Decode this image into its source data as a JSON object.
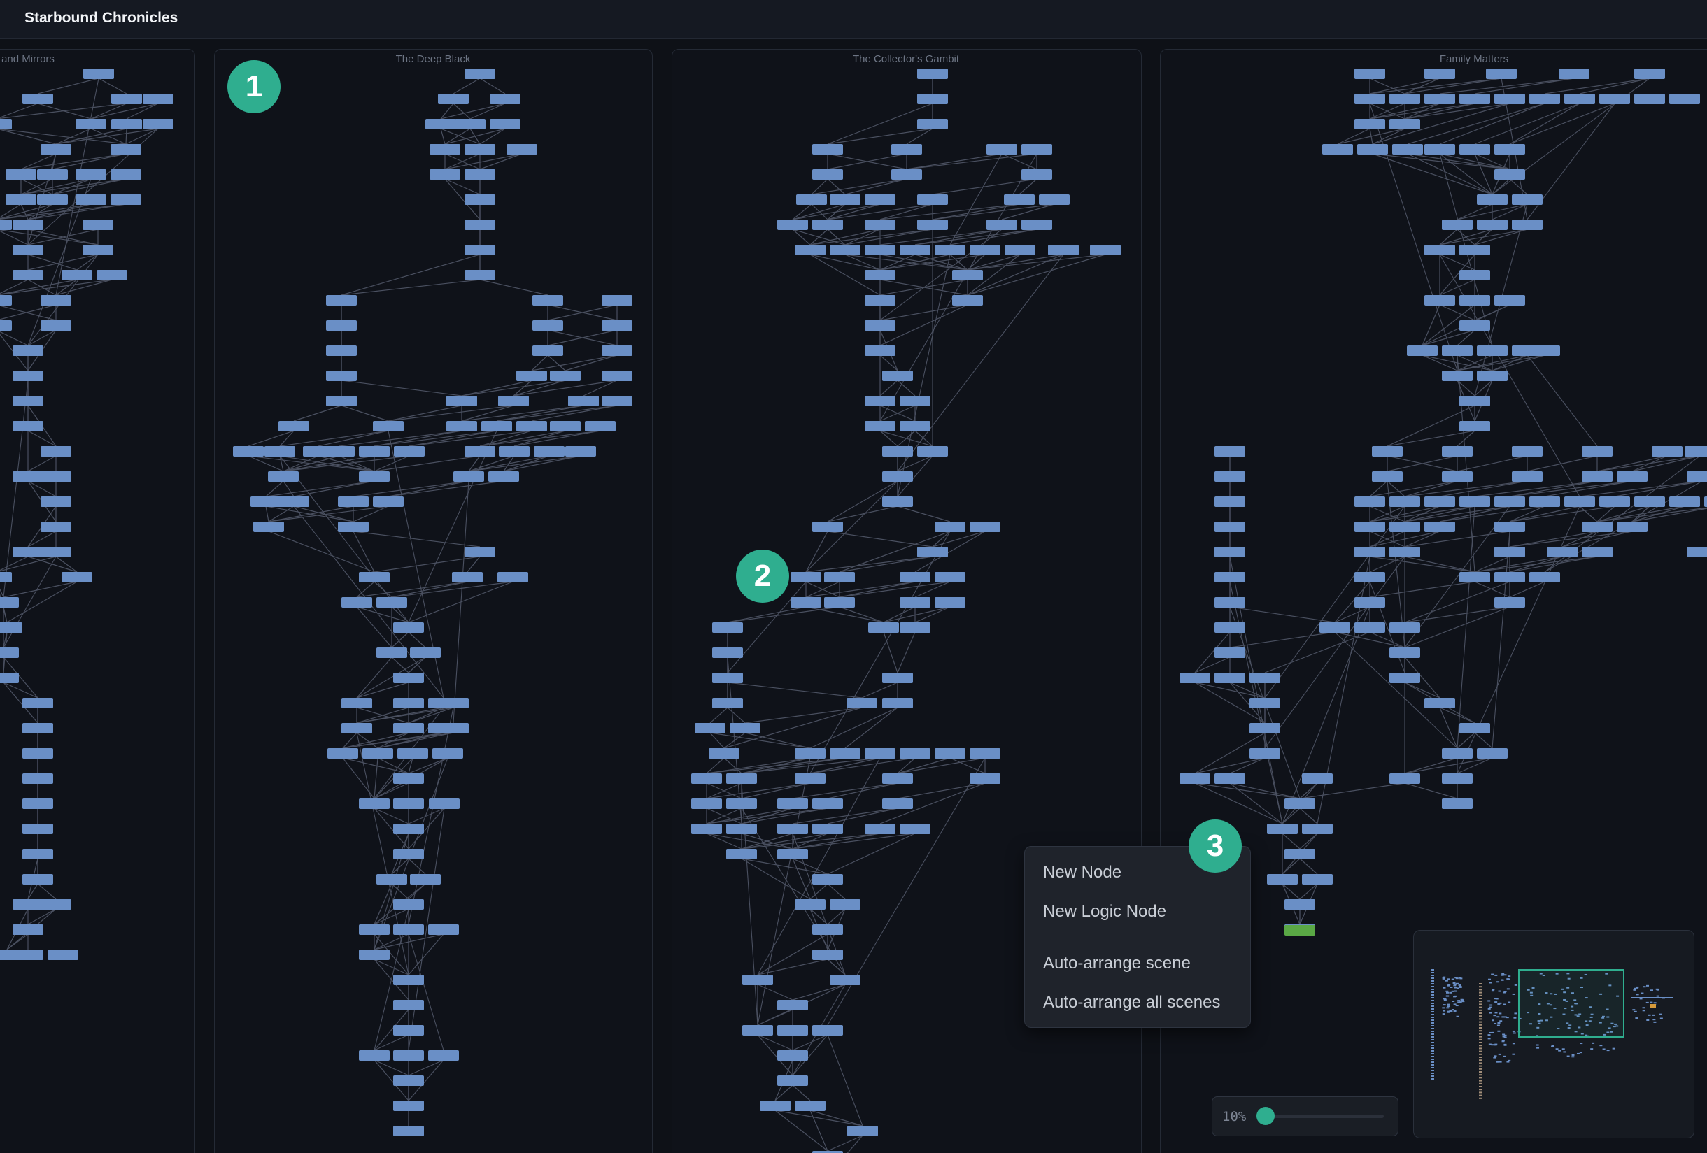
{
  "app": {
    "title": "Starbound Chronicles"
  },
  "scenes": [
    {
      "title": "and Mirrors"
    },
    {
      "title": "The Deep Black"
    },
    {
      "title": "The Collector's Gambit"
    },
    {
      "title": "Family Matters"
    }
  ],
  "callouts": [
    "1",
    "2",
    "3"
  ],
  "context_menu": {
    "items": [
      "New Node",
      "New Logic Node",
      "Auto-arrange scene",
      "Auto-arrange all scenes"
    ]
  },
  "zoom": {
    "label": "10%",
    "level": 0.1
  },
  "colors": {
    "node": "#6a8fc6",
    "selected_node": "#5aa845",
    "edge": "#4a5060",
    "accent": "#2fae8f",
    "background": "#0e1117"
  }
}
